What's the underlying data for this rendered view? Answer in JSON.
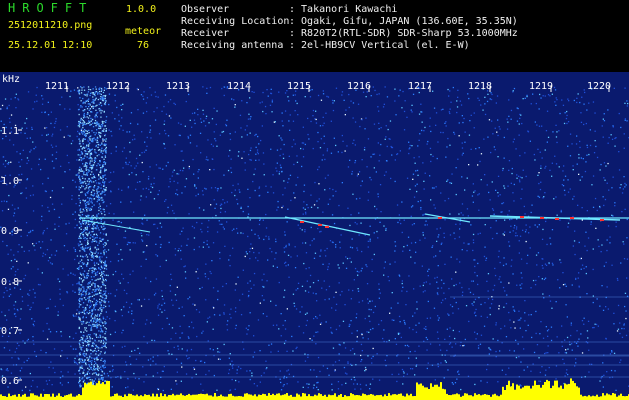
{
  "header": {
    "app_name": "HROFFT",
    "version": "1.0.0",
    "filename": "2512011210.png",
    "mode": "meteor",
    "datetime": "25.12.01 12:10",
    "count": "76"
  },
  "info": [
    {
      "label": "Observer",
      "value": ": Takanori Kawachi"
    },
    {
      "label": "Receiving Location",
      "value": ": Ogaki, Gifu, JAPAN (136.60E, 35.35N)"
    },
    {
      "label": "Receiver",
      "value": ": R820T2(RTL-SDR) SDR-Sharp 53.1000MHz"
    },
    {
      "label": "Receiving antenna",
      "value": ": 2el-HB9CV Vertical (el. E-W)"
    }
  ],
  "plot": {
    "unit_label": "kHz",
    "time_ticks": [
      "1211",
      "1212",
      "1213",
      "1214",
      "1215",
      "1216",
      "1217",
      "1218",
      "1219",
      "1220"
    ],
    "freq_ticks": [
      "1.1",
      "1.0",
      "0.9",
      "0.8",
      "0.7",
      "0.6"
    ],
    "colors": {
      "background": "#0a1a6e",
      "noise": "#2a6aff",
      "echo": "#6fe8ff",
      "hot": "#ff3030",
      "bar": "#ffff00",
      "text": "#ffffff"
    }
  }
}
